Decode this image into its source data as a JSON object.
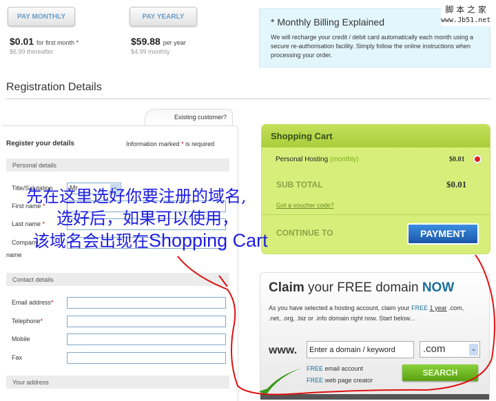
{
  "pricing": {
    "monthly": {
      "button": "PAY MONTHLY",
      "price": "$0.01",
      "price_note": "for first month *",
      "sub": "$6.99 thereafter"
    },
    "yearly": {
      "button": "PAY YEARLY",
      "price": "$59.88",
      "price_note": "per year",
      "sub": "$4.99 monthly"
    }
  },
  "billing": {
    "title": "* Monthly Billing Explained",
    "text": "We will recharge your credit / debit card automatically each month using a secure re-authorisation facility. Simply follow the online instructions when processing your order."
  },
  "watermark": {
    "line1": "脚 本 之 家",
    "line2": "www.Jb51.net"
  },
  "page_title": "Registration Details",
  "form": {
    "existing_tab": "Existing customer?",
    "title": "Register your details",
    "required_note_pre": "Information marked ",
    "required_star": "*",
    "required_note_post": " is required",
    "personal_header": "Personal details",
    "salutation_label": "Title/Salutation",
    "salutation_value": "Mr",
    "first_name": "First name",
    "last_name": "Last name",
    "company": "Company",
    "company2": "name",
    "contact_header": "Contact details",
    "email": "Email address",
    "telephone": "Telephone",
    "mobile": "Mobile",
    "fax": "Fax",
    "address_header": "Your address"
  },
  "cart": {
    "title": "Shopping Cart",
    "item": "Personal Hosting",
    "item_period": "(monthly)",
    "item_price": "$0.01",
    "subtotal_label": "SUB TOTAL",
    "subtotal": "$0.01",
    "voucher": "Got a voucher code?",
    "continue": "CONTINUE TO",
    "payment": "PAYMENT"
  },
  "claim": {
    "title_bold": "Claim",
    "title_mid": " your FREE domain ",
    "title_now": "NOW",
    "text_pre": "As you have selected a hosting account, claim your ",
    "text_free": "FREE",
    "text_link": "1 year",
    "text_post": " .com, .net, .org, .biz or .info domain right now. Start below...",
    "www": "www.",
    "domain_placeholder": "Enter a domain / keyword",
    "tld": ".com",
    "free": "FREE",
    "email_account": " email account",
    "web_creator": " web page creator",
    "search": "SEARCH"
  },
  "annotation": {
    "line1": "先在这里选好你要注册的域名,",
    "line2": "选好后，如果可以使用，",
    "line3_cn": "该域名会出现在",
    "line3_en": "Shopping Cart"
  },
  "colors": {
    "cart_bg": "#d8ee7a",
    "payment_blue": "#1c62b9",
    "search_green": "#6cb51e",
    "annotation_blue": "#1d1de0",
    "annotation_red": "#e01010"
  }
}
